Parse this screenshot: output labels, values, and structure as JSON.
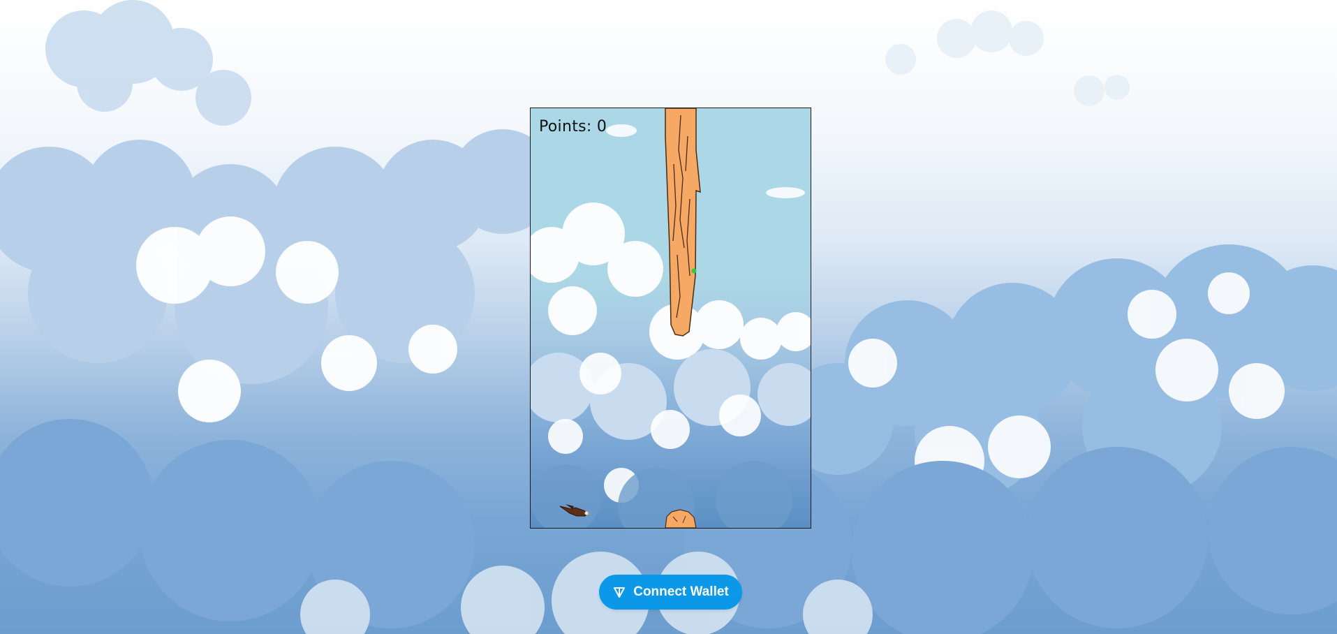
{
  "hud": {
    "points_label": "Points:",
    "points_value": "0",
    "points_text": "Points: 0"
  },
  "wallet": {
    "connect_label": "Connect Wallet",
    "icon": "ton-diamond-icon"
  },
  "game": {
    "player": "eagle-sprite",
    "obstacle_top": "tree-trunk-top",
    "obstacle_bottom": "tree-stump-bottom",
    "collectible": "green-gem"
  },
  "colors": {
    "sky": "#acd7e6",
    "button": "#0b98e8",
    "trunk": "#f6a865"
  }
}
